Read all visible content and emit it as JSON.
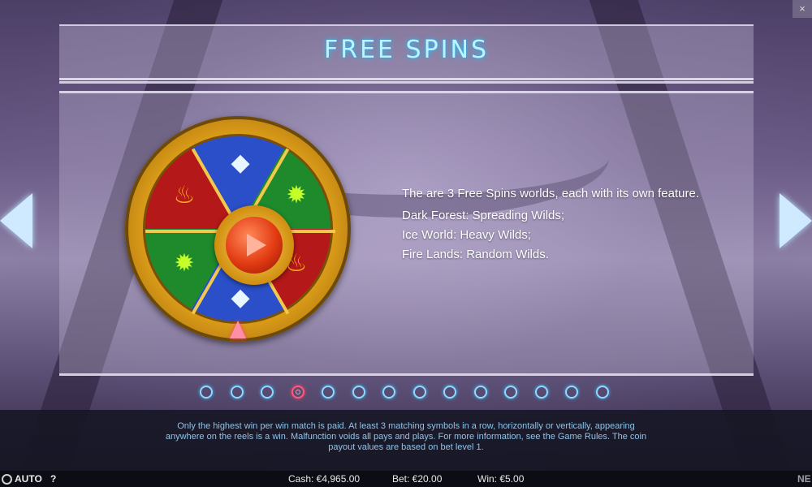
{
  "title": "FREE SPINS",
  "description": {
    "intro": "The are 3 Free Spins worlds, each with its own feature.",
    "features": [
      "Dark Forest: Spreading Wilds;",
      "Ice World: Heavy Wilds;",
      "Fire Lands: Random Wilds."
    ]
  },
  "wheel": {
    "segments": [
      "ice",
      "forest",
      "fire",
      "ice",
      "forest",
      "fire"
    ],
    "center_button": "play-icon"
  },
  "pagination": {
    "total": 14,
    "active": 4
  },
  "rules_text": "Only the highest win per win match is paid. At least 3 matching symbols in a row, horizontally or vertically, appearing anywhere on the reels is a win. Malfunction voids all pays and plays. For more information, see the Game Rules. The coin payout values are based on bet level 1.",
  "bottom_bar": {
    "auto_label": "AUTO",
    "help_label": "?",
    "cash": "Cash: €4,965.00",
    "bet": "Bet: €20.00",
    "win": "Win: €5.00",
    "brand_partial": "NE"
  },
  "close_label": "×",
  "colors": {
    "title_glow": "#2ec9ff",
    "active_dot": "#ff5a7a",
    "dot": "#8fd8ff",
    "rules_text": "#8fc4e8"
  }
}
